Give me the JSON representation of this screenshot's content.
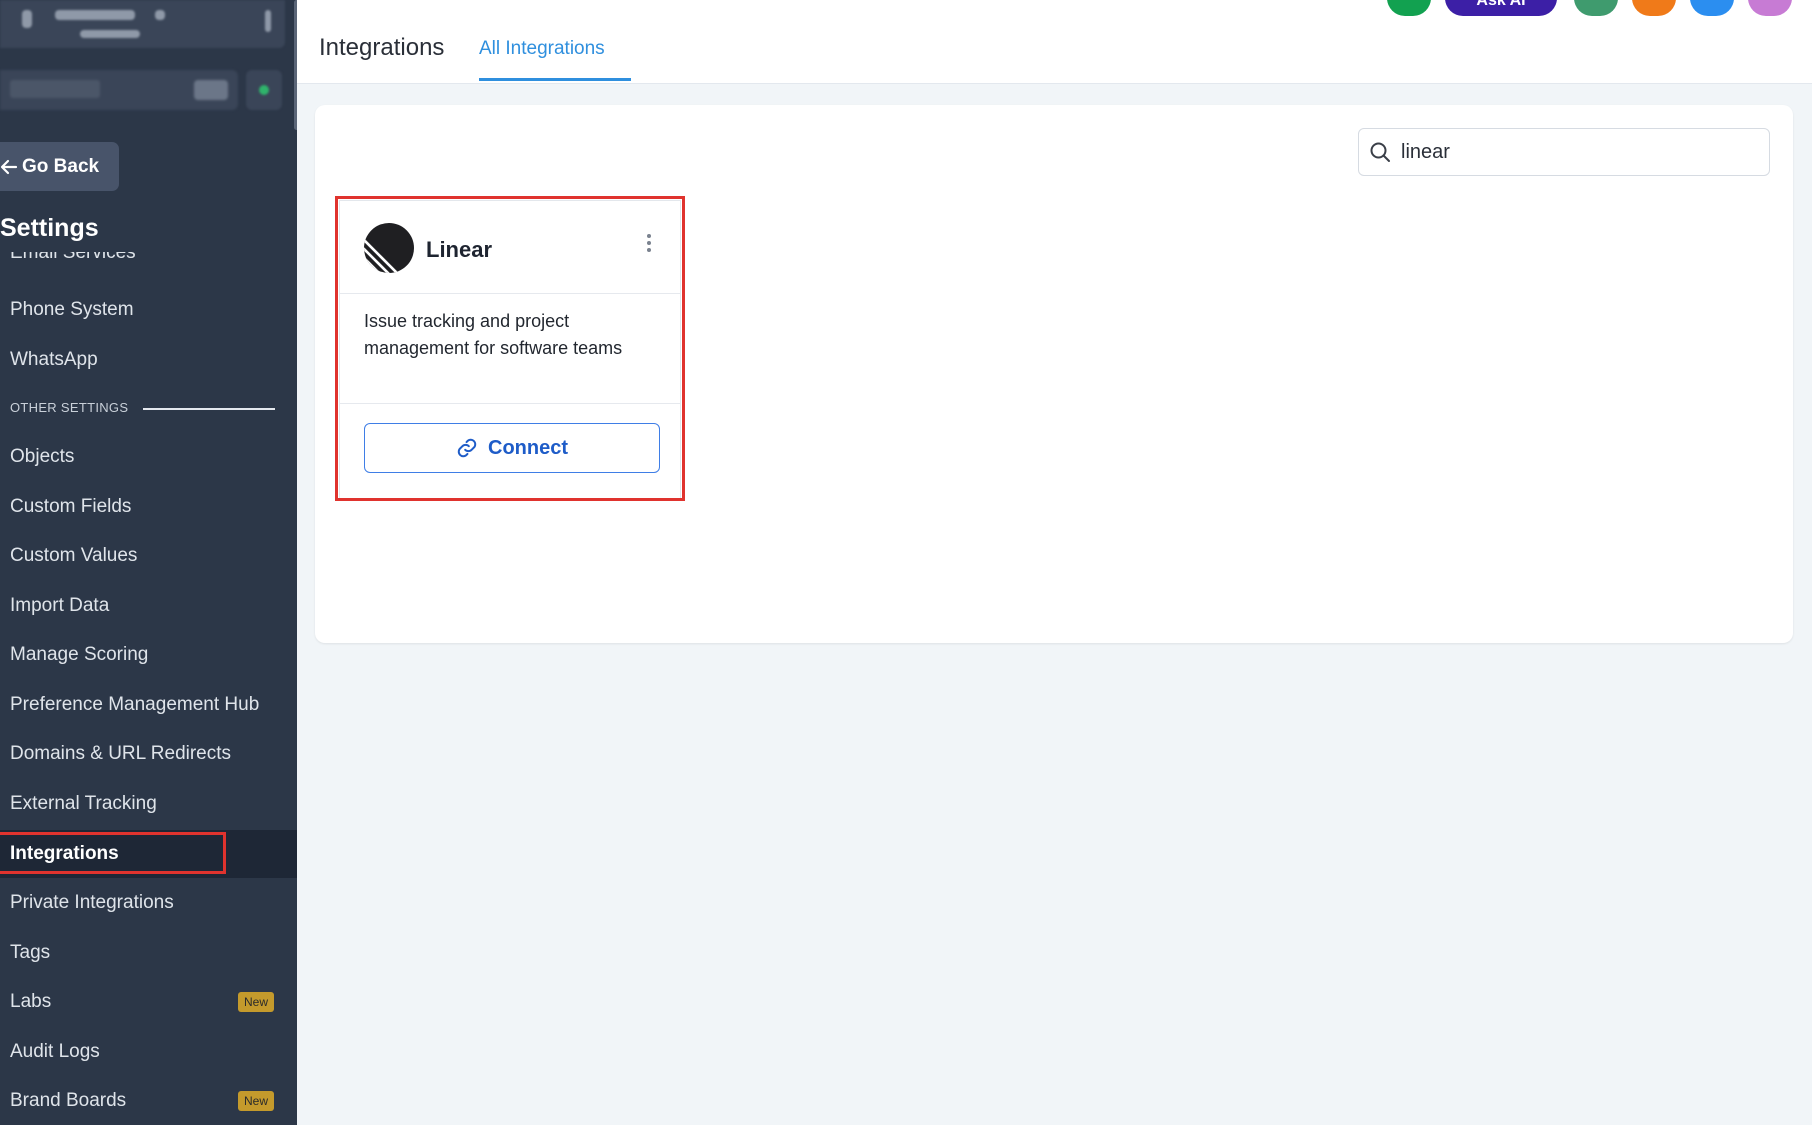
{
  "sidebar": {
    "go_back_label": "Go Back",
    "settings_title": "Settings",
    "clipped_item_label": "Email Services",
    "section_label": "OTHER SETTINGS",
    "items": [
      {
        "label": "Phone System"
      },
      {
        "label": "WhatsApp"
      },
      {
        "label": "Objects"
      },
      {
        "label": "Custom Fields"
      },
      {
        "label": "Custom Values"
      },
      {
        "label": "Import Data"
      },
      {
        "label": "Manage Scoring"
      },
      {
        "label": "Preference Management Hub"
      },
      {
        "label": "Domains & URL Redirects"
      },
      {
        "label": "External Tracking"
      },
      {
        "label": "Integrations",
        "active": true
      },
      {
        "label": "Private Integrations"
      },
      {
        "label": "Tags"
      },
      {
        "label": "Labs",
        "badge": "New"
      },
      {
        "label": "Audit Logs"
      },
      {
        "label": "Brand Boards",
        "badge": "New"
      }
    ]
  },
  "header": {
    "title": "Integrations",
    "tab_label": "All Integrations",
    "ask_ai_label": "Ask AI"
  },
  "search": {
    "value": "linear"
  },
  "integration_card": {
    "name": "Linear",
    "description": "Issue tracking and project management for software teams",
    "connect_label": "Connect"
  },
  "colors": {
    "sidebar_bg": "#2c3748",
    "accent": "#2f8fde",
    "highlight": "#e0332e",
    "badge": "#c49a2c"
  }
}
